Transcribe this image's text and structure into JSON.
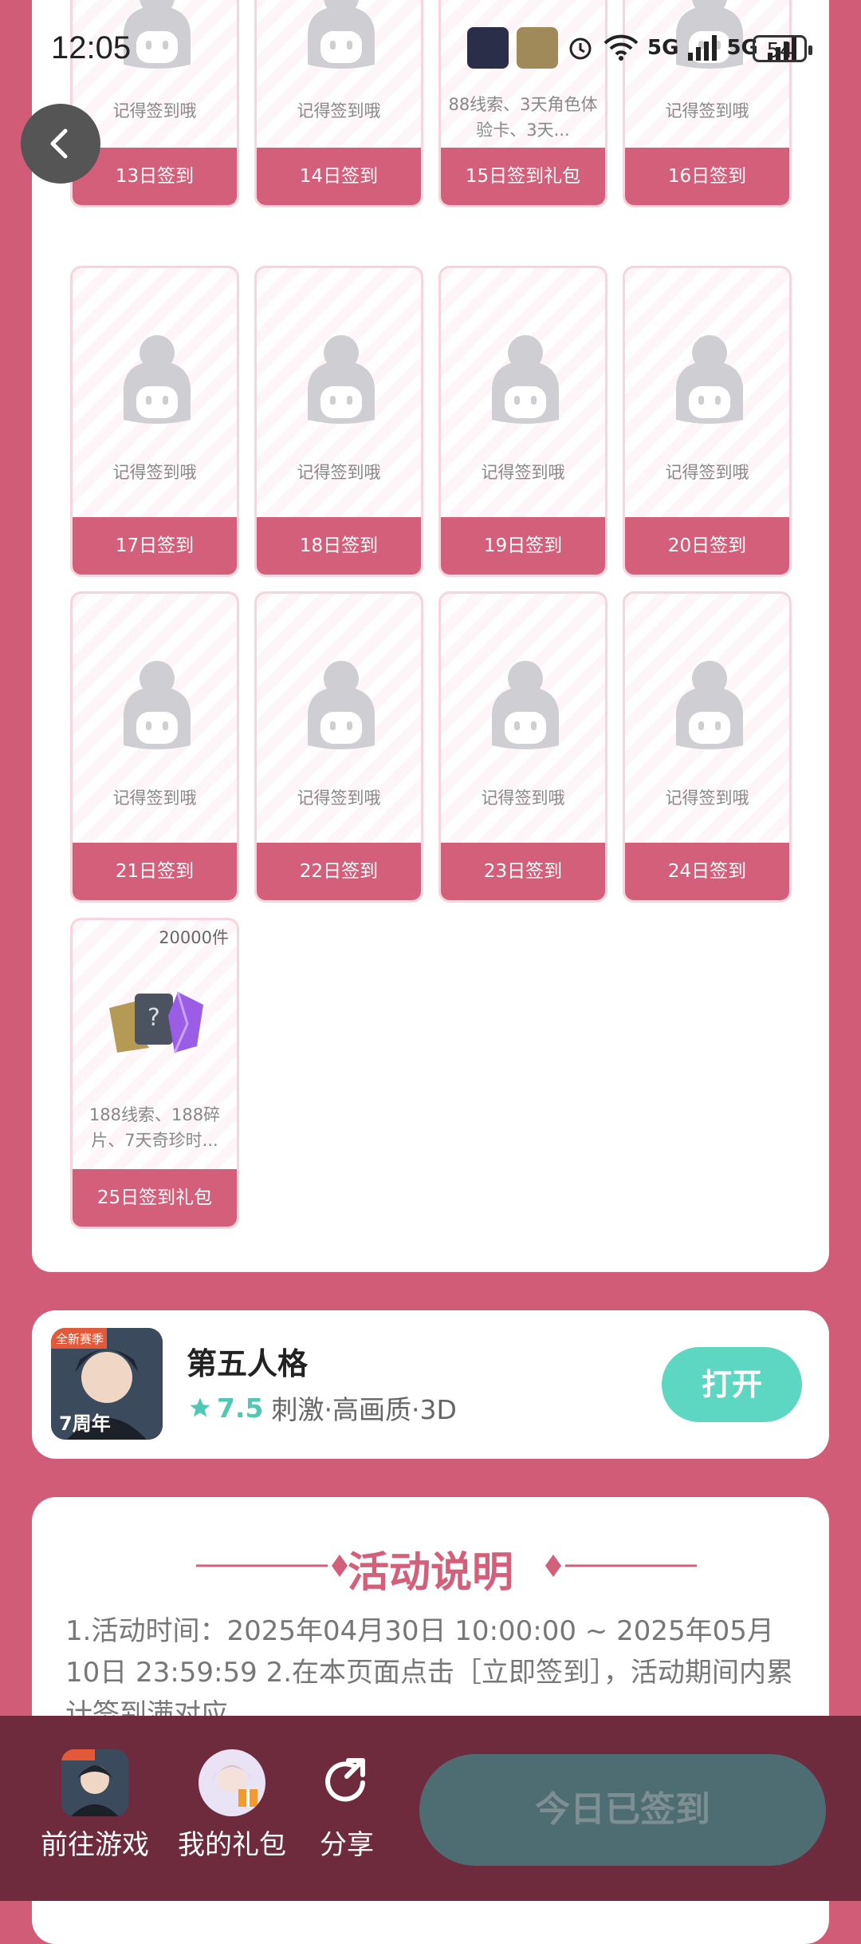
{
  "status_bar": {
    "time": "12:05",
    "network_1": "5G",
    "network_2": "5G",
    "battery": "54"
  },
  "checkin_grid": {
    "cells": [
      {
        "footer": "13日签到",
        "text": "记得签到哦"
      },
      {
        "footer": "14日签到",
        "text": "记得签到哦"
      },
      {
        "footer": "15日签到礼包",
        "text": "88线索、3天角色体验卡、3天..."
      },
      {
        "footer": "16日签到",
        "text": "记得签到哦"
      },
      {
        "footer": "17日签到",
        "text": "记得签到哦"
      },
      {
        "footer": "18日签到",
        "text": "记得签到哦"
      },
      {
        "footer": "19日签到",
        "text": "记得签到哦"
      },
      {
        "footer": "20日签到",
        "text": "记得签到哦"
      },
      {
        "footer": "21日签到",
        "text": "记得签到哦"
      },
      {
        "footer": "22日签到",
        "text": "记得签到哦"
      },
      {
        "footer": "23日签到",
        "text": "记得签到哦"
      },
      {
        "footer": "24日签到",
        "text": "记得签到哦"
      },
      {
        "footer": "25日签到礼包",
        "text": "188线索、188碎片、7天奇珍时...",
        "count": "20000件"
      }
    ]
  },
  "game_card": {
    "title": "第五人格",
    "rating": "7.5",
    "tags": "刺激·高画质·3D",
    "open_label": "打开",
    "icon_badge": "全新赛季",
    "icon_anniv": "7周年"
  },
  "description": {
    "title": "活动说明",
    "text": "1.活动时间：2025年04月30日 10:00:00 ~ 2025年05月10日 23:59:59 2.在本页面点击［立即签到］，活动期间内累计签到满对应"
  },
  "bottom_bar": {
    "go_game": "前往游戏",
    "my_gifts": "我的礼包",
    "share": "分享",
    "signed_label": "今日已签到"
  },
  "colors": {
    "page_bg": "#d05c78",
    "accent_pink": "#d35f7a",
    "teal": "#5dd6c2",
    "bottom_bar": "#6e2b3e",
    "signed_button": "#4d6d72"
  }
}
